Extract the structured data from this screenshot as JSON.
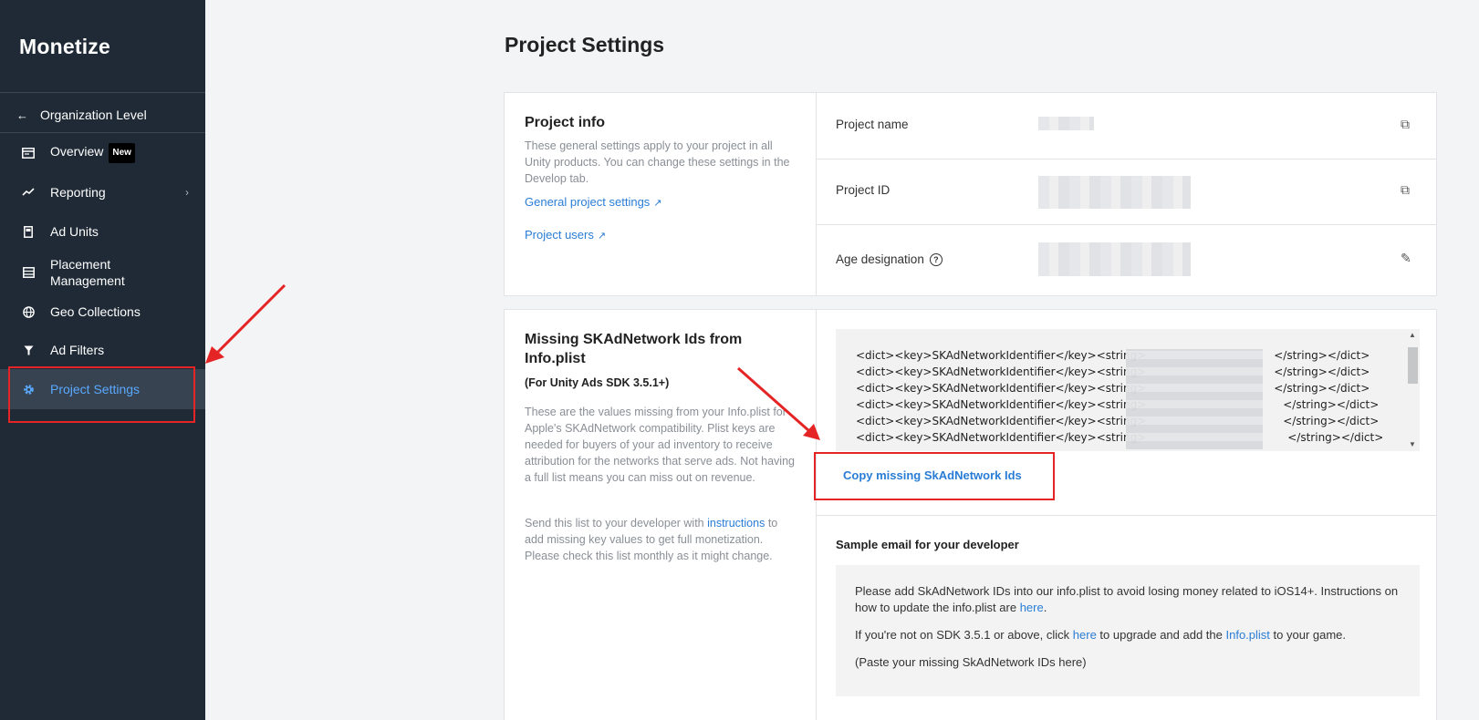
{
  "sidebar": {
    "brand": "Monetize",
    "org_label": "Organization Level",
    "items": [
      {
        "label": "Overview",
        "badge": "New",
        "icon": "overview-icon"
      },
      {
        "label": "Reporting",
        "icon": "reporting-icon"
      },
      {
        "label": "Ad Units",
        "icon": "ad-units-icon"
      },
      {
        "label": "Placement Management",
        "icon": "placement-icon"
      },
      {
        "label": "Geo Collections",
        "icon": "globe-icon"
      },
      {
        "label": "Ad Filters",
        "icon": "filter-icon"
      },
      {
        "label": "Project Settings",
        "icon": "gear-icon",
        "active": true
      }
    ]
  },
  "main": {
    "title": "Project Settings",
    "project_info": {
      "heading": "Project info",
      "description": "These general settings apply to your project in all Unity products. You can change these settings in the Develop tab.",
      "link_general": "General project settings",
      "link_users": "Project users",
      "fields": [
        {
          "label": "Project name"
        },
        {
          "label": "Project ID"
        },
        {
          "label": "Age designation"
        }
      ]
    },
    "skad": {
      "heading": "Missing SKAdNetwork Ids from Info.plist",
      "subheading": "(For Unity Ads SDK 3.5.1+)",
      "description": "These are the values missing from your Info.plist for Apple's SKAdNetwork compatibility. Plist keys are needed for buyers of your ad inventory to receive attribution for the networks that serve ads. Not having a full list means you can miss out on revenue.",
      "send_pre": "Send this list to your developer with ",
      "send_link": "instructions",
      "send_post": " to add missing key values to get full monetization. Please check this list monthly as it might change.",
      "code_lines": [
        "<dict><key>SKAdNetworkIdentifier</key><string>",
        "<dict><key>SKAdNetworkIdentifier</key><string>",
        "<dict><key>SKAdNetworkIdentifier</key><string>",
        "<dict><key>SKAdNetworkIdentifier</key><string>",
        "<dict><key>SKAdNetworkIdentifier</key><string>",
        "<dict><key>SKAdNetworkIdentifier</key><string>"
      ],
      "code_ends": [
        "</string></dict>",
        "</string></dict>",
        "</string></dict>",
        "</string></dict>",
        "</string></dict>",
        "</string></dict>"
      ],
      "copy_button": "Copy missing SkAdNetwork Ids",
      "email_title": "Sample email for your developer",
      "email_p1_pre": "Please add SkAdNetwork IDs into our info.plist to avoid losing money related to iOS14+. Instructions on how to update the info.plist are ",
      "email_p1_link": "here",
      "email_p1_post": ".",
      "email_p2_pre": "If you're not on SDK 3.5.1 or above, click ",
      "email_p2_link": "here",
      "email_p2_mid": " to upgrade and add the ",
      "email_p2_link2": "Info.plist",
      "email_p2_post": " to your game.",
      "email_p3": "(Paste your missing SkAdNetwork IDs here)"
    }
  },
  "colors": {
    "sidebar_bg": "#1f2a36",
    "accent": "#2a7dd6",
    "annotation": "#e52525"
  }
}
